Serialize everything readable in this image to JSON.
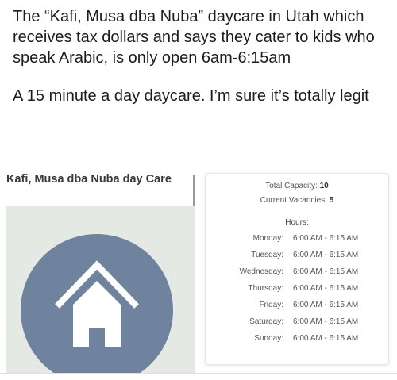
{
  "post": {
    "paragraph1": "The “Kafi, Musa dba Nuba” daycare in Utah which receives tax dollars and says they cater to kids who speak Arabic, is only open 6am-6:15am",
    "paragraph2": "A 15 minute a day daycare. I’m sure it’s totally legit"
  },
  "listing": {
    "provider_name": "Kafi, Musa dba Nuba day Care",
    "image_icon": "house-icon",
    "colors": {
      "image_bg": "#e4e9e3",
      "circle": "#6f839e",
      "house": "#ffffff"
    },
    "capacity_label": "Total Capacity:",
    "capacity_value": "10",
    "vacancies_label": "Current Vacancies:",
    "vacancies_value": "5",
    "hours_title": "Hours:",
    "hours": [
      {
        "day": "Monday:",
        "time": "6:00 AM - 6:15 AM"
      },
      {
        "day": "Tuesday:",
        "time": "6:00 AM - 6:15 AM"
      },
      {
        "day": "Wednesday:",
        "time": "6:00 AM - 6:15 AM"
      },
      {
        "day": "Thursday:",
        "time": "6:00 AM - 6:15 AM"
      },
      {
        "day": "Friday:",
        "time": "6:00 AM - 6:15 AM"
      },
      {
        "day": "Saturday:",
        "time": "6:00 AM - 6:15 AM"
      },
      {
        "day": "Sunday:",
        "time": "6:00 AM - 6:15 AM"
      }
    ]
  }
}
